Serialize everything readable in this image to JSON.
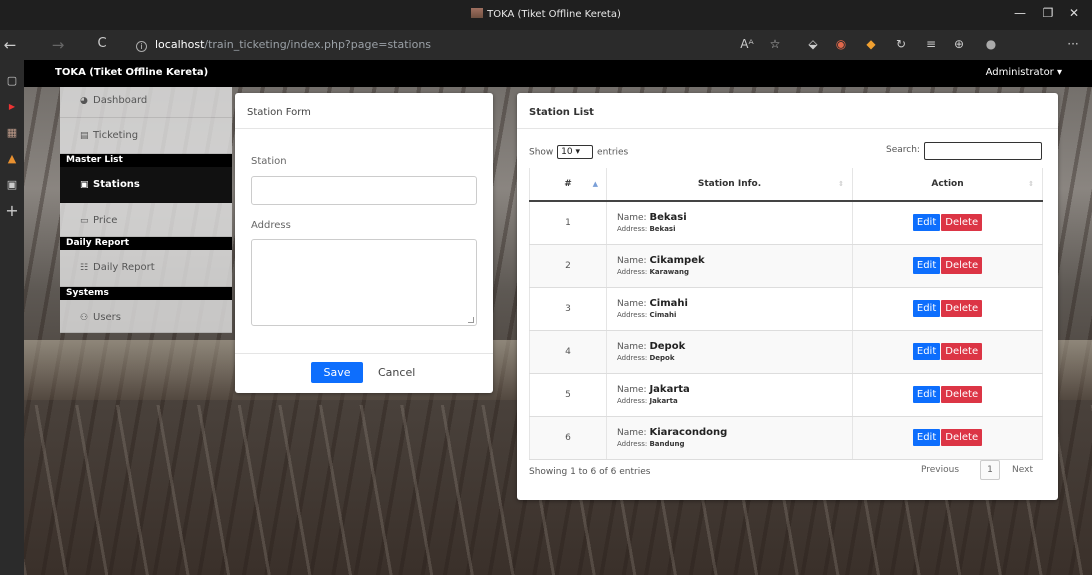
{
  "window": {
    "title": "TOKA (Tiket Offline Kereta)",
    "minimize": "—",
    "restore": "❐",
    "close": "✕"
  },
  "browser": {
    "back": "←",
    "forward": "→",
    "reload": "C",
    "url_host": "localhost",
    "url_path": "/train_ticketing/index.php?page=stations",
    "toolbar_icons": [
      "Aᴬ",
      "☆",
      "⬙",
      "◉",
      "◆",
      "↻",
      "≡",
      "⊕",
      "●",
      "···"
    ]
  },
  "vertical_tabs": [
    "▢",
    "▶",
    "▦",
    "▲",
    "▣",
    "+"
  ],
  "app": {
    "brand": "TOKA (Tiket Offline Kereta)",
    "user": "Administrator ▾"
  },
  "sidebar": {
    "dashboard": "Dashboard",
    "ticketing": "Ticketing",
    "master_header": "Master List",
    "stations": "Stations",
    "price": "Price",
    "daily_header": "Daily Report",
    "daily_report": "Daily Report",
    "systems_header": "Systems",
    "users": "Users"
  },
  "form": {
    "title": "Station Form",
    "station_label": "Station",
    "station_value": "",
    "address_label": "Address",
    "address_value": "",
    "save": "Save",
    "cancel": "Cancel"
  },
  "list": {
    "title": "Station List",
    "show": "Show",
    "entries_value": "10 ▾",
    "entries": "entries",
    "search_label": "Search:",
    "search_value": "",
    "columns": [
      "#",
      "Station Info.",
      "Action"
    ],
    "name_prefix": "Name: ",
    "address_prefix": "Address: ",
    "edit": "Edit",
    "delete": "Delete",
    "rows": [
      {
        "no": "1",
        "name": "Bekasi",
        "address": "Bekasi"
      },
      {
        "no": "2",
        "name": "Cikampek",
        "address": "Karawang"
      },
      {
        "no": "3",
        "name": "Cimahi",
        "address": "Cimahi"
      },
      {
        "no": "4",
        "name": "Depok",
        "address": "Depok"
      },
      {
        "no": "5",
        "name": "Jakarta",
        "address": "Jakarta"
      },
      {
        "no": "6",
        "name": "Kiaracondong",
        "address": "Bandung"
      }
    ],
    "info": "Showing 1 to 6 of 6 entries",
    "previous": "Previous",
    "page": "1",
    "next": "Next"
  }
}
